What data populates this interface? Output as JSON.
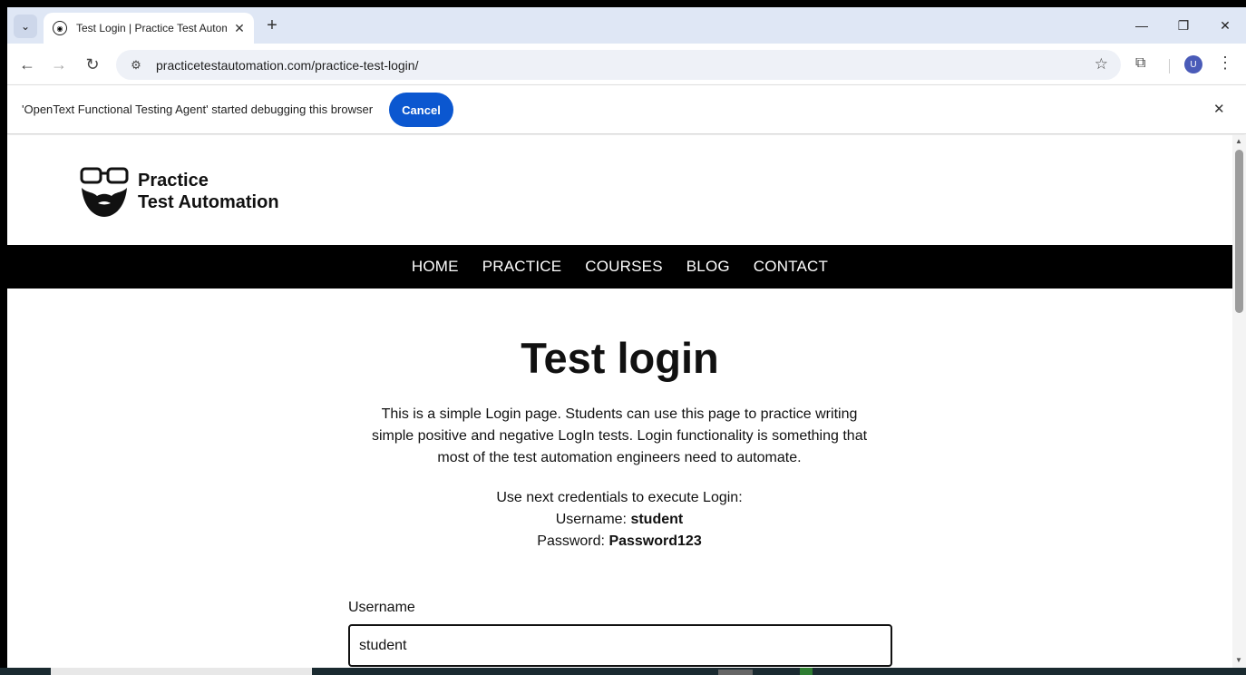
{
  "browser": {
    "tab_title": "Test Login | Practice Test Autom",
    "tab_close": "✕",
    "new_tab": "+",
    "url": "practicetestautomation.com/practice-test-login/"
  },
  "infobar": {
    "message": "'OpenText Functional Testing Agent' started debugging this browser",
    "cancel_label": "Cancel"
  },
  "site": {
    "logo_line1": "Practice",
    "logo_line2": "Test Automation",
    "nav": [
      "HOME",
      "PRACTICE",
      "COURSES",
      "BLOG",
      "CONTACT"
    ]
  },
  "page": {
    "title": "Test login",
    "intro": "This is a simple Login page. Students can use this page to practice writing simple positive and negative LogIn tests. Login functionality is something that most of the test automation engineers need to automate.",
    "creds_intro": "Use next credentials to execute Login:",
    "username_label": "Username:",
    "username_value": "student",
    "password_label": "Password:",
    "password_value": "Password123",
    "field_username_label": "Username",
    "field_username_value": "student"
  },
  "profile_initial": "U",
  "colors": {
    "accent": "#0b57d0",
    "tabstrip": "#dfe7f5",
    "nav_bg": "#000000"
  }
}
